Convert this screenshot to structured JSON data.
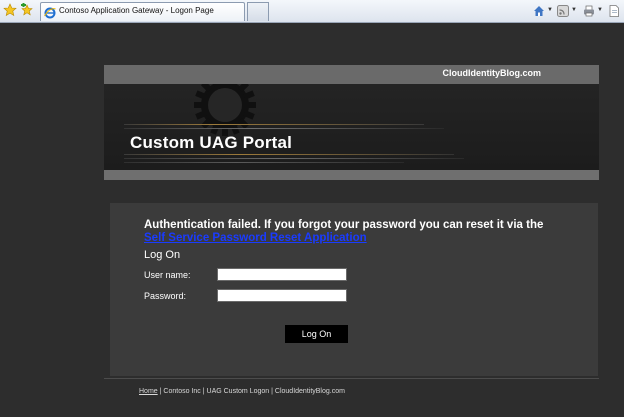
{
  "browser": {
    "tab_title": "Contoso Application Gateway - Logon Page",
    "favorites_icon": "star-icon",
    "add_favorites_icon": "add-favorites-icon",
    "toolbar_icons": [
      "home-icon",
      "feeds-icon",
      "print-icon",
      "page-icon"
    ]
  },
  "header": {
    "site_link": "CloudIdentityBlog.com",
    "portal_title": "Custom UAG Portal"
  },
  "main": {
    "error_text": "Authentication failed. If you forgot your password you can reset it via the",
    "error_link": "Self Service Password Reset Application",
    "logon_heading": "Log On",
    "username_label": "User name:",
    "username_value": "",
    "password_label": "Password:",
    "password_value": "",
    "logon_button": "Log On"
  },
  "footer": {
    "home_link": "Home",
    "separator": "|",
    "company": "Contoso Inc",
    "page_name": "UAG Custom Logon",
    "site": "CloudIdentityBlog.com"
  },
  "colors": {
    "page_background": "#2d2d2d",
    "panel_background": "#3b3b3b",
    "link_blue": "#1a3bff"
  }
}
